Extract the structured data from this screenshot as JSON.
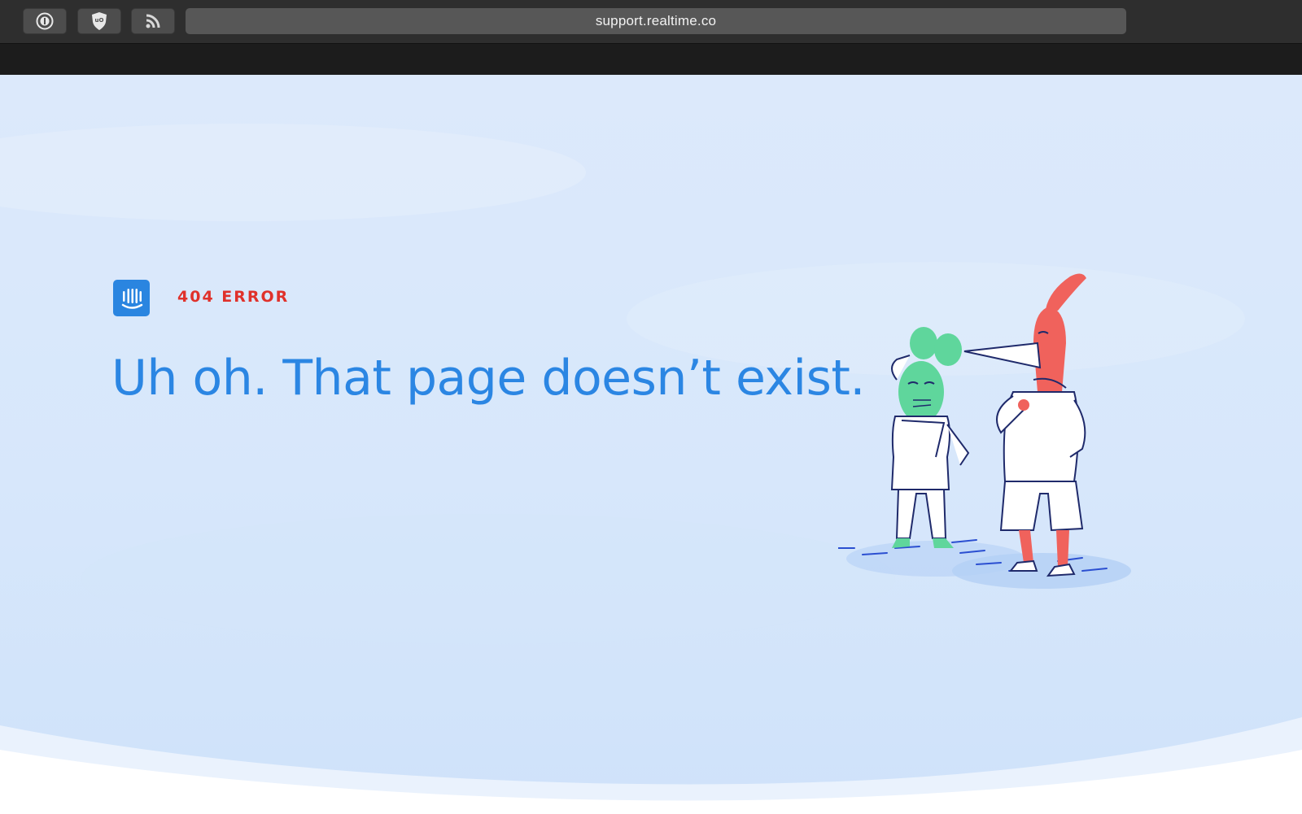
{
  "browser": {
    "url": "support.realtime.co",
    "extensions": [
      {
        "icon": "password-manager-icon"
      },
      {
        "icon": "ublock-shield-icon"
      },
      {
        "icon": "rss-feed-icon"
      }
    ]
  },
  "page": {
    "error_label": "404 ERROR",
    "headline": "Uh oh. That page doesn’t exist.",
    "colors": {
      "accent_blue": "#2b86e3",
      "error_red": "#e0312b",
      "background_blue": "#dbe9fb",
      "mouse_green": "#5fd69c",
      "bird_red": "#f0625c",
      "line_navy": "#1f2a6b"
    }
  }
}
